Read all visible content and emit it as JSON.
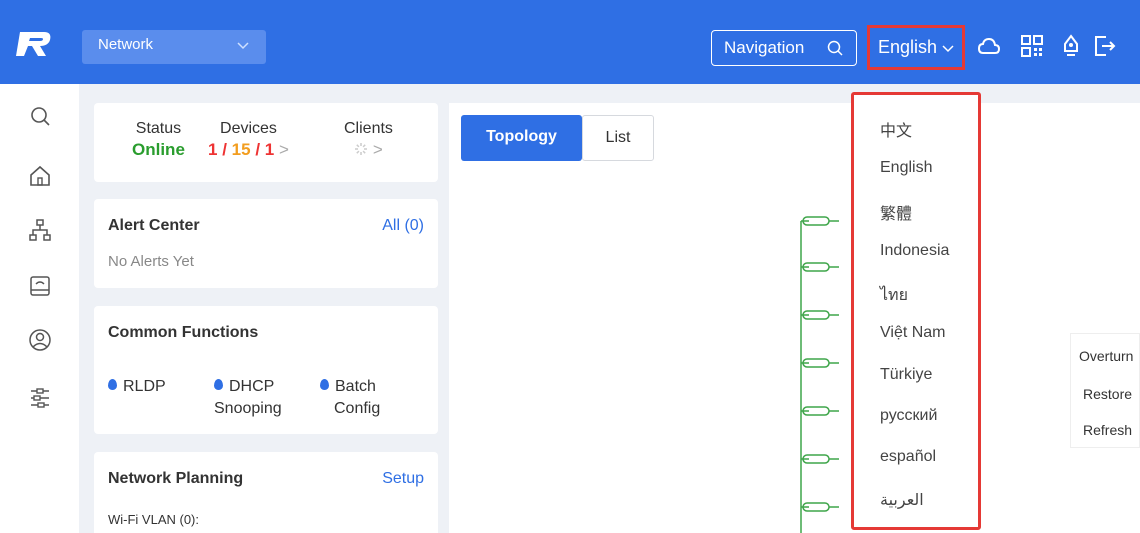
{
  "header": {
    "project_label": "Network",
    "navigation_label": "Navigation",
    "language_label": "English"
  },
  "status_card": {
    "status_label": "Status",
    "status_value": "Online",
    "devices_label": "Devices",
    "devices_a": "1",
    "devices_b": "15",
    "devices_c": "1",
    "sep": "/",
    "clients_label": "Clients",
    "chev": ">"
  },
  "alert_card": {
    "title": "Alert Center",
    "link": "All (0)",
    "message": "No Alerts Yet"
  },
  "functions_card": {
    "title": "Common Functions",
    "items": [
      {
        "line1": "RLDP",
        "line2": ""
      },
      {
        "line1": "DHCP",
        "line2": "Snooping"
      },
      {
        "line1": "Batch",
        "line2": "Config"
      }
    ]
  },
  "planning_card": {
    "title": "Network Planning",
    "link": "Setup",
    "wifi_vlan": "Wi-Fi VLAN (0):"
  },
  "main": {
    "tabs": [
      {
        "label": "Topology",
        "active": true
      },
      {
        "label": "List",
        "active": false
      }
    ]
  },
  "side_menu": {
    "items": [
      "Overturn",
      "Restore",
      "Refresh"
    ]
  },
  "language_menu": {
    "items": [
      "中文",
      "English",
      "繁體",
      "Indonesia",
      "ไทย",
      "Việt Nam",
      "Türkiye",
      "русский",
      "español",
      "العربية"
    ]
  },
  "colors": {
    "brand": "#2f6fe4",
    "highlight": "#e53935",
    "online": "#2a9d2e",
    "topology_line": "#3fa54a"
  }
}
